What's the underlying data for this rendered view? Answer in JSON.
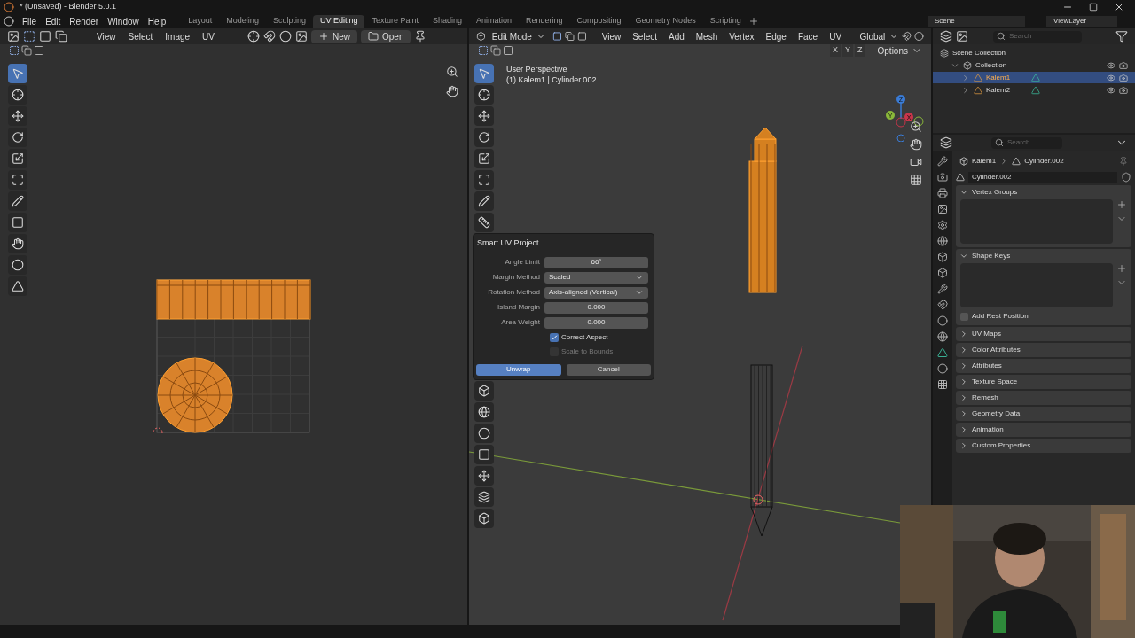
{
  "window": {
    "title": "* (Unsaved) - Blender 5.0.1"
  },
  "menu": [
    "File",
    "Edit",
    "Render",
    "Window",
    "Help"
  ],
  "workspaces": [
    {
      "label": "Layout",
      "selected": false
    },
    {
      "label": "Modeling",
      "selected": false
    },
    {
      "label": "Sculpting",
      "selected": false
    },
    {
      "label": "UV Editing",
      "selected": true
    },
    {
      "label": "Texture Paint",
      "selected": false
    },
    {
      "label": "Shading",
      "selected": false
    },
    {
      "label": "Animation",
      "selected": false
    },
    {
      "label": "Rendering",
      "selected": false
    },
    {
      "label": "Compositing",
      "selected": false
    },
    {
      "label": "Geometry Nodes",
      "selected": false
    },
    {
      "label": "Scripting",
      "selected": false
    }
  ],
  "scene": "Scene",
  "view_layer": "ViewLayer",
  "uv_editor": {
    "menus": [
      "View",
      "Select",
      "Image",
      "UV"
    ],
    "buttons": [
      "New",
      "Open"
    ]
  },
  "viewport": {
    "mode": "Edit Mode",
    "menus": [
      "View",
      "Select",
      "Add",
      "Mesh",
      "Vertex",
      "Edge",
      "Face",
      "UV"
    ],
    "orientation": "Global",
    "axes": [
      "X",
      "Y",
      "Z"
    ],
    "options": "Options",
    "overlay_lines": [
      "User Perspective",
      "(1) Kalem1 | Cylinder.002"
    ],
    "gizmo_axes": [
      "Z",
      "Y",
      "X"
    ]
  },
  "dialog": {
    "title": "Smart UV Project",
    "fields": [
      {
        "kind": "number",
        "label": "Angle Limit",
        "value": "66°"
      },
      {
        "kind": "dropdown",
        "label": "Margin Method",
        "value": "Scaled"
      },
      {
        "kind": "dropdown",
        "label": "Rotation Method",
        "value": "Axis-aligned (Vertical)"
      },
      {
        "kind": "number",
        "label": "Island Margin",
        "value": "0.000"
      },
      {
        "kind": "number",
        "label": "Area Weight",
        "value": "0.000"
      },
      {
        "kind": "checkbox",
        "label": "Correct Aspect",
        "checked": true,
        "disabled": false
      },
      {
        "kind": "checkbox",
        "label": "Scale to Bounds",
        "checked": false,
        "disabled": true
      }
    ],
    "buttons": [
      {
        "label": "Unwrap",
        "selected": true
      },
      {
        "label": "Cancel",
        "selected": false
      }
    ]
  },
  "outliner": {
    "search_placeholder": "Search",
    "tree": [
      {
        "name": "Scene Collection",
        "kind": "scene",
        "children": [
          {
            "name": "Collection",
            "kind": "collection",
            "expanded": true,
            "children": [
              {
                "name": "Kalem1",
                "kind": "object",
                "selected": true
              },
              {
                "name": "Kalem2",
                "kind": "object",
                "selected": false
              }
            ]
          }
        ]
      }
    ]
  },
  "properties": {
    "search_placeholder": "Search",
    "breadcrumb": [
      "Kalem1",
      "Cylinder.002"
    ],
    "data_name": "Cylinder.002",
    "panels": [
      {
        "title": "Vertex Groups",
        "expanded": true
      },
      {
        "title": "Shape Keys",
        "expanded": true,
        "option": {
          "label": "Add Rest Position",
          "checked": false
        }
      },
      {
        "title": "UV Maps",
        "expanded": false
      },
      {
        "title": "Color Attributes",
        "expanded": false
      },
      {
        "title": "Attributes",
        "expanded": false
      },
      {
        "title": "Texture Space",
        "expanded": false
      },
      {
        "title": "Remesh",
        "expanded": false
      },
      {
        "title": "Geometry Data",
        "expanded": false
      },
      {
        "title": "Animation",
        "expanded": false
      },
      {
        "title": "Custom Properties",
        "expanded": false
      }
    ]
  }
}
